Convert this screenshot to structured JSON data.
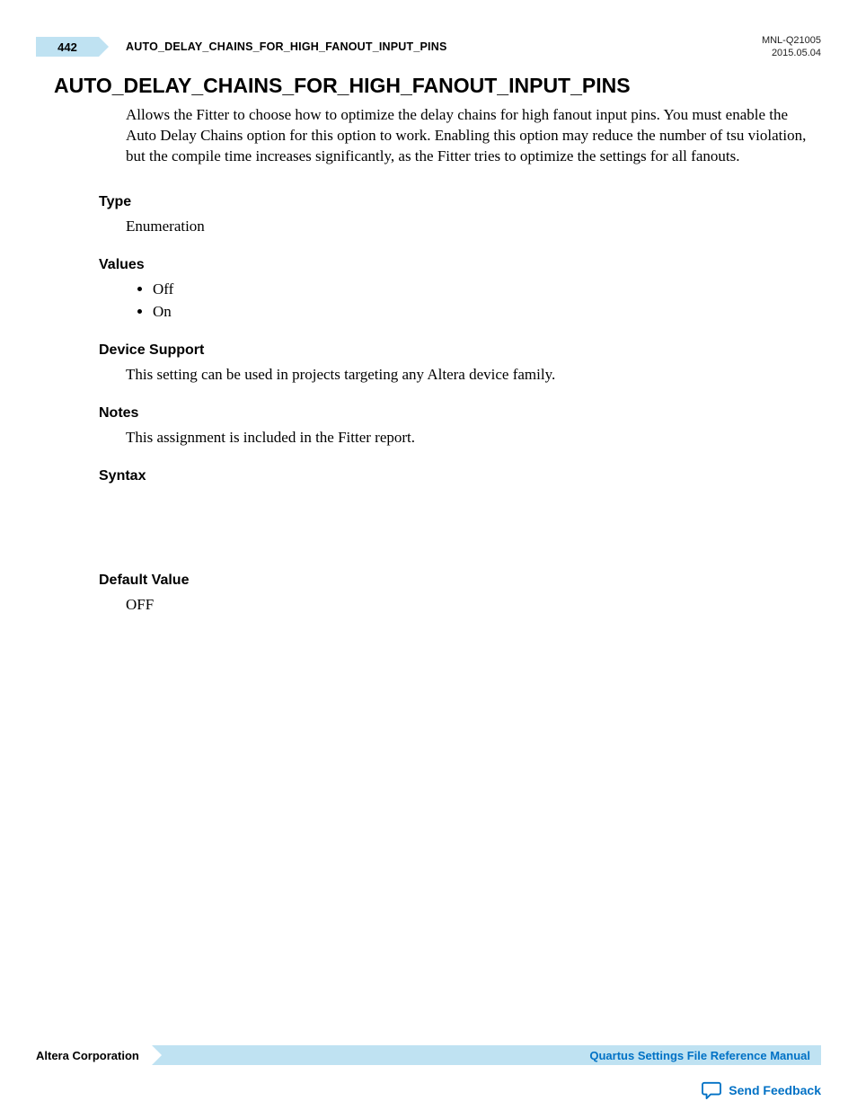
{
  "header": {
    "page_number": "442",
    "running_title": "AUTO_DELAY_CHAINS_FOR_HIGH_FANOUT_INPUT_PINS",
    "doc_ref": "MNL-Q21005",
    "doc_date": "2015.05.04"
  },
  "main": {
    "title": "AUTO_DELAY_CHAINS_FOR_HIGH_FANOUT_INPUT_PINS",
    "description": "Allows the Fitter to choose how to optimize the delay chains for high fanout input pins. You must enable the Auto Delay Chains option for this option to work. Enabling this option may reduce the number of tsu violation, but the compile time increases significantly, as the Fitter tries to optimize the settings for all fanouts.",
    "sections": {
      "type_heading": "Type",
      "type_value": "Enumeration",
      "values_heading": "Values",
      "values": [
        "Off",
        "On"
      ],
      "device_support_heading": "Device Support",
      "device_support_body": "This setting can be used in projects targeting any Altera device family.",
      "notes_heading": "Notes",
      "notes_body": "This assignment is included in the Fitter report.",
      "syntax_heading": "Syntax",
      "default_value_heading": "Default Value",
      "default_value_body": "OFF"
    }
  },
  "footer": {
    "company": "Altera Corporation",
    "manual_title": "Quartus Settings File Reference Manual",
    "feedback_label": "Send Feedback"
  }
}
